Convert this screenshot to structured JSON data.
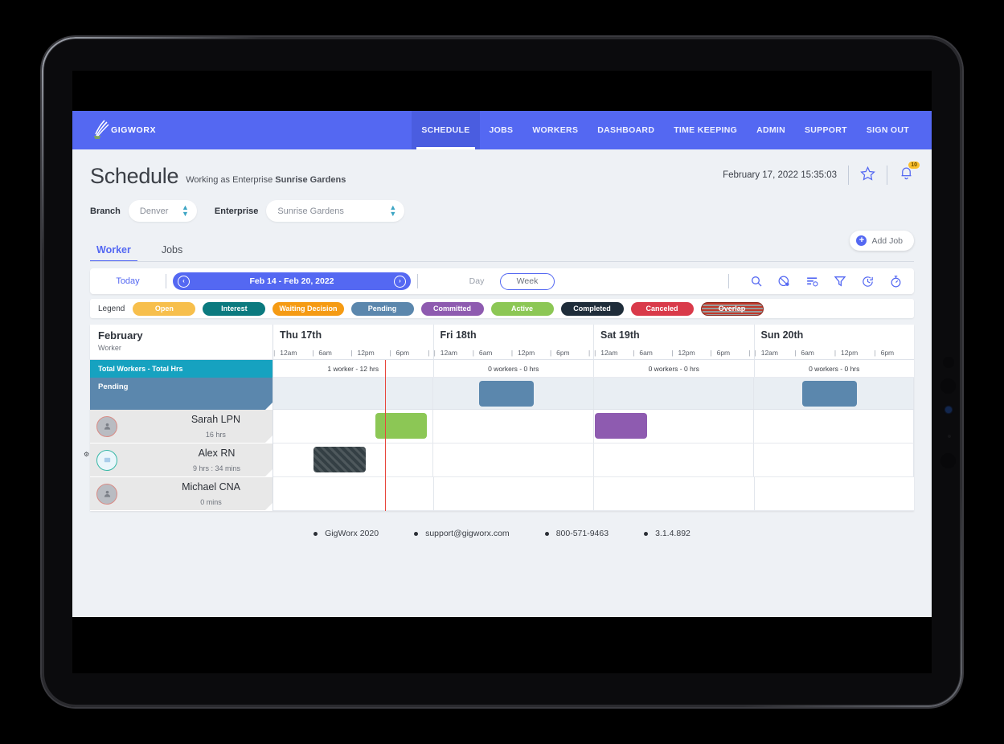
{
  "topnav": {
    "brand": "GIGWORX",
    "items": [
      {
        "label": "SCHEDULE",
        "active": true
      },
      {
        "label": "JOBS",
        "active": false
      },
      {
        "label": "WORKERS",
        "active": false
      },
      {
        "label": "DASHBOARD",
        "active": false
      },
      {
        "label": "TIME KEEPING",
        "active": false
      },
      {
        "label": "ADMIN",
        "active": false
      },
      {
        "label": "SUPPORT",
        "active": false
      },
      {
        "label": "SIGN OUT",
        "active": false
      }
    ]
  },
  "header": {
    "title": "Schedule",
    "working_prefix": "Working as Enterprise",
    "working_entity": "Sunrise Gardens",
    "timestamp": "February 17, 2022 15:35:03",
    "notification_count": "10"
  },
  "filters": {
    "branch_label": "Branch",
    "branch_value": "Denver",
    "enterprise_label": "Enterprise",
    "enterprise_value": "Sunrise Gardens"
  },
  "tabs": [
    {
      "label": "Worker",
      "active": true
    },
    {
      "label": "Jobs",
      "active": false
    }
  ],
  "add_job_label": "Add Job",
  "toolbar": {
    "today_label": "Today",
    "date_range": "Feb 14 - Feb 20, 2022",
    "prev_glyph": "‹",
    "next_glyph": "›",
    "day_label": "Day",
    "week_label": "Week",
    "tools": [
      {
        "name": "search-icon"
      },
      {
        "name": "no-show-icon"
      },
      {
        "name": "sort-list-icon"
      },
      {
        "name": "filter-icon"
      },
      {
        "name": "clock-refresh-icon"
      },
      {
        "name": "stopwatch-icon"
      }
    ]
  },
  "legend": {
    "label": "Legend",
    "chips": [
      {
        "label": "Open",
        "color": "#f7bf4c"
      },
      {
        "label": "Interest",
        "color": "#0b7a7f"
      },
      {
        "label": "Waiting Decision",
        "color": "#f59b14"
      },
      {
        "label": "Pending",
        "color": "#5b87ad"
      },
      {
        "label": "Committed",
        "color": "#8e5bb0"
      },
      {
        "label": "Active",
        "color": "#8cc755"
      },
      {
        "label": "Completed",
        "color": "#1f2d3a"
      },
      {
        "label": "Canceled",
        "color": "#d93a4a"
      },
      {
        "label": "Overlap",
        "color": "#c0392b"
      }
    ]
  },
  "grid": {
    "month_label": "February",
    "left_sub_label": "Worker",
    "total_row_label": "Total Workers - Total Hrs",
    "pending_row_label": "Pending",
    "ticks": [
      "12am",
      "6am",
      "12pm",
      "6pm"
    ],
    "days": [
      {
        "name": "Thu 17th",
        "total": "1 worker - 12 hrs"
      },
      {
        "name": "Fri 18th",
        "total": "0 workers - 0 hrs"
      },
      {
        "name": "Sat 19th",
        "total": "0 workers - 0 hrs"
      },
      {
        "name": "Sun 20th",
        "total": "0 workers - 0 hrs"
      }
    ],
    "workers": [
      {
        "name": "Sarah LPN",
        "hours": "16 hrs"
      },
      {
        "name": "Alex RN",
        "hours": "9 hrs : 34 mins"
      },
      {
        "name": "Michael CNA",
        "hours": "0 mins"
      }
    ],
    "blocks": {
      "pending": [
        {
          "left_pct": 32.1,
          "width_pct": 8.6,
          "color": "#5b87ad"
        },
        {
          "left_pct": 82.5,
          "width_pct": 8.6,
          "color": "#5b87ad"
        }
      ],
      "sarah": [
        {
          "left_pct": 15.9,
          "width_pct": 8.1,
          "color": "#8cc755"
        },
        {
          "left_pct": 50.2,
          "width_pct": 8.1,
          "color": "#8e5bb0"
        }
      ],
      "alex": [
        {
          "left_pct": 6.3,
          "width_pct": 8.1,
          "color": "#343f44",
          "pattern": "hatched"
        }
      ],
      "michael": []
    },
    "now_line_pct": 17.4
  },
  "footer": [
    {
      "text": "GigWorx 2020"
    },
    {
      "text": "support@gigworx.com"
    },
    {
      "text": "800-571-9463"
    },
    {
      "text": "3.1.4.892"
    }
  ]
}
